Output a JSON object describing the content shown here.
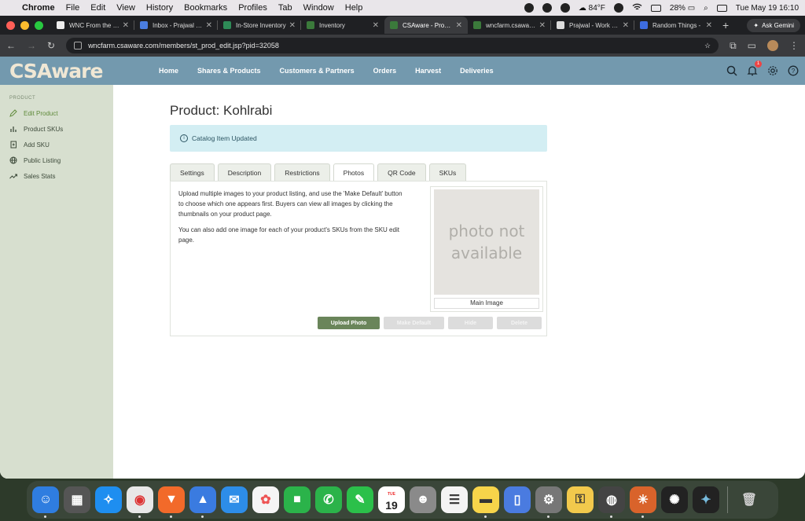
{
  "menubar": {
    "app": "Chrome",
    "items": [
      "File",
      "Edit",
      "View",
      "History",
      "Bookmarks",
      "Profiles",
      "Tab",
      "Window",
      "Help"
    ],
    "weather": "84°F",
    "battery": "28%",
    "datetime": "Tue May 19  16:10"
  },
  "browser": {
    "tabs": [
      {
        "title": "WNC From the Gr",
        "color": "#eeeeee"
      },
      {
        "title": "Inbox - Prajwal Pa",
        "color": "#4a7de0"
      },
      {
        "title": "In-Store Inventory",
        "color": "#2e8b57"
      },
      {
        "title": "Inventory",
        "color": "#3b7a3b"
      },
      {
        "title": "CSAware - Produc",
        "color": "#3b7a3b"
      },
      {
        "title": "wncfarm.csaware.",
        "color": "#3b7a3b"
      },
      {
        "title": "Prajwal - Work - C",
        "color": "#dddddd"
      },
      {
        "title": "Random Things -",
        "color": "#3d6ce0"
      }
    ],
    "ask_gemini": "Ask Gemini",
    "url": "wncfarm.csaware.com/members/st_prod_edit.jsp?pid=32058"
  },
  "header": {
    "logo": "CSAware",
    "nav": [
      "Home",
      "Shares & Products",
      "Customers & Partners",
      "Orders",
      "Harvest",
      "Deliveries"
    ],
    "notification_count": "1"
  },
  "sidebar": {
    "heading": "PRODUCT",
    "items": [
      {
        "label": "Edit Product",
        "icon": "pencil-icon",
        "active": true
      },
      {
        "label": "Product SKUs",
        "icon": "bar-chart-icon"
      },
      {
        "label": "Add SKU",
        "icon": "document-icon"
      },
      {
        "label": "Public Listing",
        "icon": "globe-icon"
      },
      {
        "label": "Sales Stats",
        "icon": "trend-icon"
      }
    ]
  },
  "main": {
    "title": "Product: Kohlrabi",
    "alert": "Catalog Item Updated",
    "tabs": [
      "Settings",
      "Description",
      "Restrictions",
      "Photos",
      "QR Code",
      "SKUs"
    ],
    "active_tab": "Photos",
    "paragraph1": "Upload multiple images to your product listing, and use the 'Make Default' button to choose which one appears first. Buyers can view all images by clicking the thumbnails on your product page.",
    "paragraph2": "You can also add one image for each of your product's SKUs from the SKU edit page.",
    "photo_placeholder": "photo not available",
    "photo_caption": "Main Image",
    "buttons": {
      "upload": "Upload Photo",
      "make_default": "Make Default",
      "hide": "Hide",
      "delete": "Delete"
    }
  },
  "dock": {
    "calendar_month": "TUE",
    "calendar_day": "19"
  }
}
